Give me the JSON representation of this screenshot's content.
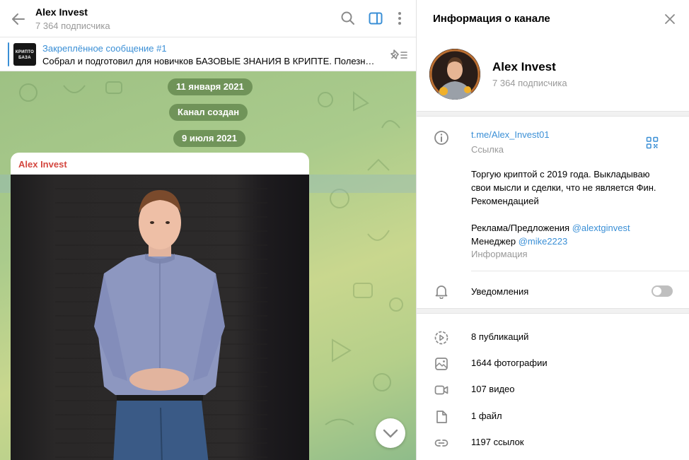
{
  "chat": {
    "title": "Alex Invest",
    "subscribers": "7 364 подписчика",
    "pinned": {
      "title": "Закреплённое сообщение #1",
      "text": "Собрал и подготовил для новичков БАЗОВЫЕ ЗНАНИЯ В КРИПТЕ. Полезн…",
      "thumb_text_1": "КРИПТО",
      "thumb_text_2": "БАЗА"
    },
    "date_1": "11 января 2021",
    "service": "Канал создан",
    "date_2": "9 июля 2021",
    "message": {
      "author": "Alex Invest"
    }
  },
  "info": {
    "title": "Информация о канале",
    "name": "Alex Invest",
    "subscribers": "7 364 подписчика",
    "link": "t.me/Alex_Invest01",
    "link_label": "Ссылка",
    "description_lines": [
      "Торгую криптой с 2019 года. Выкладываю",
      "свои мысли и сделки, что не является Фин.",
      "Рекомендацией"
    ],
    "ads_prefix": "Реклама/Предложения ",
    "ads_mention": "@alextginvest",
    "manager_prefix": "Менеджер ",
    "manager_mention": "@mike2223",
    "description_label": "Информация",
    "notifications_label": "Уведомления",
    "notifications_on": false,
    "media": [
      {
        "label": "8 публикаций",
        "icon": "publications-icon"
      },
      {
        "label": "1644 фотографии",
        "icon": "photos-icon"
      },
      {
        "label": "107 видео",
        "icon": "video-icon"
      },
      {
        "label": "1 файл",
        "icon": "file-icon"
      },
      {
        "label": "1197 ссылок",
        "icon": "links-icon"
      }
    ]
  },
  "colors": {
    "accent": "#3a8fd6",
    "author": "#d4473f",
    "pill_bg": "#5c8046"
  }
}
